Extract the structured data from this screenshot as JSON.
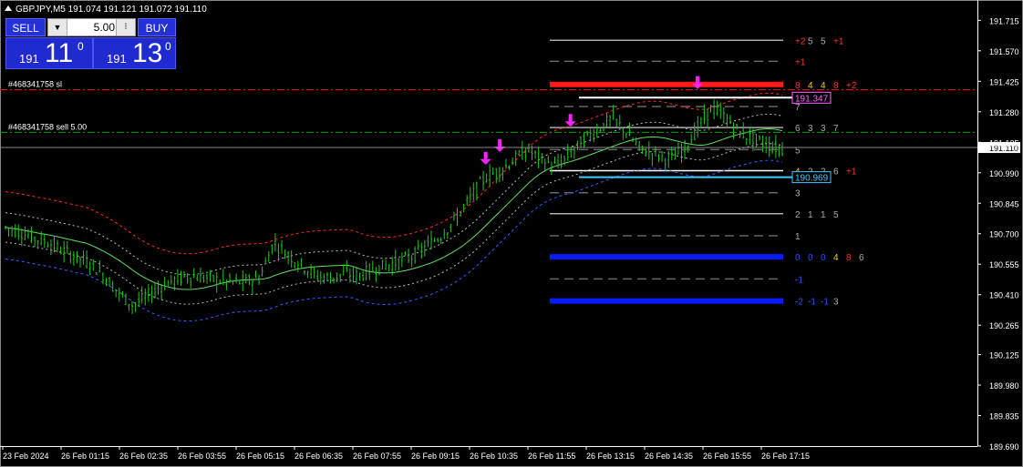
{
  "header": {
    "symbol_line": "GBPJPY,M5  191.074 191.121 191.072 191.110"
  },
  "trade_panel": {
    "sell_label": "SELL",
    "buy_label": "BUY",
    "lot_value": "5.00",
    "sell_prefix": "191",
    "sell_big": "11",
    "sell_sup": "0",
    "buy_prefix": "191",
    "buy_big": "13",
    "buy_sup": "0"
  },
  "annotations": {
    "order_sl_label": "#468341758 sl",
    "order_entry_label": "#468341758 sell 5.00",
    "price_tag_high": "191.347",
    "price_tag_low": "190.969",
    "current_price_tag": "191.110"
  },
  "colors": {
    "bullish_candle": "#22c522",
    "axis_text": "#ffffff",
    "grid_gray": "#888888",
    "sl_line": "#ff0000",
    "entry_line": "#00aa00",
    "upper_band": "#ff2a2a",
    "lower_band": "#3060ff",
    "arrow_marker": "#ff22ff",
    "level_red": "#ff1a1a",
    "level_blue": "#0b1bff"
  },
  "chart_data": {
    "type": "candlestick",
    "symbol": "GBPJPY",
    "timeframe": "M5",
    "ylim": [
      189.69,
      191.79
    ],
    "y_ticks": [
      "191.715",
      "191.570",
      "191.425",
      "191.280",
      "191.135",
      "190.990",
      "190.845",
      "190.700",
      "190.555",
      "190.410",
      "190.265",
      "190.125",
      "189.980",
      "189.835",
      "189.690"
    ],
    "x_ticks": [
      "23 Feb 2024",
      "26 Feb 01:15",
      "26 Feb 02:35",
      "26 Feb 03:55",
      "26 Feb 05:15",
      "26 Feb 06:35",
      "26 Feb 07:55",
      "26 Feb 09:15",
      "26 Feb 10:35",
      "26 Feb 11:55",
      "26 Feb 13:15",
      "26 Feb 14:35",
      "26 Feb 15:55",
      "26 Feb 17:15"
    ],
    "close_path": [
      190.73,
      190.71,
      190.68,
      190.66,
      190.62,
      190.59,
      190.56,
      190.5,
      190.42,
      190.36,
      190.4,
      190.45,
      190.48,
      190.5,
      190.49,
      190.48,
      190.47,
      190.47,
      190.49,
      190.66,
      190.6,
      190.55,
      190.5,
      190.49,
      190.51,
      190.5,
      190.53,
      190.55,
      190.57,
      190.6,
      190.65,
      190.7,
      190.78,
      190.88,
      190.97,
      191.0,
      191.05,
      191.1,
      191.05,
      191.02,
      191.08,
      191.15,
      191.2,
      191.25,
      191.18,
      191.1,
      191.08,
      191.05,
      191.1,
      191.2,
      191.3,
      191.25,
      191.18,
      191.15,
      191.12,
      191.1
    ],
    "current_price": 191.11,
    "order_sl_price": 191.385,
    "order_entry_price": 191.182,
    "levels": [
      {
        "value": 191.62,
        "color": "#aaaaaa",
        "style": "solid",
        "labels": [
          {
            "t": "+2",
            "c": "#ff3333"
          },
          {
            "t": "5",
            "c": "#aaaaaa"
          },
          {
            "t": "5",
            "c": "#aaaaaa"
          },
          {
            "t": "+1",
            "c": "#ff3333"
          }
        ]
      },
      {
        "value": 191.52,
        "color": "#666666",
        "style": "dashed",
        "labels": [
          {
            "t": "+1",
            "c": "#ff3333"
          }
        ]
      },
      {
        "value": 191.41,
        "color": "#ff1a1a",
        "style": "thick",
        "labels": [
          {
            "t": "8",
            "c": "#ff3333"
          },
          {
            "t": "4",
            "c": "#ffcc00"
          },
          {
            "t": "4",
            "c": "#ffcc00"
          },
          {
            "t": "8",
            "c": "#ff3333"
          },
          {
            "t": "+2",
            "c": "#ff3333"
          }
        ]
      },
      {
        "value": 191.305,
        "color": "#666666",
        "style": "dashed",
        "labels": [
          {
            "t": "7",
            "c": "#aaaaaa"
          }
        ]
      },
      {
        "value": 191.205,
        "color": "#aaaaaa",
        "style": "solid",
        "labels": [
          {
            "t": "6",
            "c": "#aaaaaa"
          },
          {
            "t": "3",
            "c": "#aaaaaa"
          },
          {
            "t": "3",
            "c": "#aaaaaa"
          },
          {
            "t": "7",
            "c": "#aaaaaa"
          }
        ]
      },
      {
        "value": 191.1,
        "color": "#666666",
        "style": "dashed",
        "labels": [
          {
            "t": "5",
            "c": "#aaaaaa"
          }
        ]
      },
      {
        "value": 191.0,
        "color": "#ffffff",
        "style": "solid",
        "labels": [
          {
            "t": "4",
            "c": "#ffcc00"
          },
          {
            "t": "2",
            "c": "#aaaaaa"
          },
          {
            "t": "2",
            "c": "#aaaaaa"
          },
          {
            "t": "6",
            "c": "#aaaaaa"
          },
          {
            "t": "+1",
            "c": "#ff3333"
          }
        ]
      },
      {
        "value": 190.895,
        "color": "#666666",
        "style": "dashed",
        "labels": [
          {
            "t": "3",
            "c": "#aaaaaa"
          }
        ]
      },
      {
        "value": 190.795,
        "color": "#aaaaaa",
        "style": "solid",
        "labels": [
          {
            "t": "2",
            "c": "#aaaaaa"
          },
          {
            "t": "1",
            "c": "#aaaaaa"
          },
          {
            "t": "1",
            "c": "#aaaaaa"
          },
          {
            "t": "5",
            "c": "#aaaaaa"
          }
        ]
      },
      {
        "value": 190.69,
        "color": "#666666",
        "style": "dashed",
        "labels": [
          {
            "t": "1",
            "c": "#aaaaaa"
          }
        ]
      },
      {
        "value": 190.59,
        "color": "#0b1bff",
        "style": "thick",
        "labels": [
          {
            "t": "0",
            "c": "#2255ff"
          },
          {
            "t": "0",
            "c": "#2255ff"
          },
          {
            "t": "0",
            "c": "#2255ff"
          },
          {
            "t": "4",
            "c": "#ffcc00"
          },
          {
            "t": "8",
            "c": "#ff3333"
          },
          {
            "t": "6",
            "c": "#aaaaaa"
          }
        ]
      },
      {
        "value": 190.485,
        "color": "#666666",
        "style": "dashed",
        "labels": [
          {
            "t": "-1",
            "c": "#2255ff"
          }
        ]
      },
      {
        "value": 190.38,
        "color": "#0b1bff",
        "style": "thick",
        "labels": [
          {
            "t": "-2",
            "c": "#2255ff"
          },
          {
            "t": "-1",
            "c": "#2255ff"
          },
          {
            "t": "-1",
            "c": "#2255ff"
          },
          {
            "t": "3",
            "c": "#aaaaaa"
          }
        ]
      }
    ],
    "arrows": [
      {
        "xi": 34,
        "price": 191.02
      },
      {
        "xi": 35,
        "price": 191.08
      },
      {
        "xi": 40,
        "price": 191.2
      },
      {
        "xi": 49,
        "price": 191.38
      }
    ]
  }
}
